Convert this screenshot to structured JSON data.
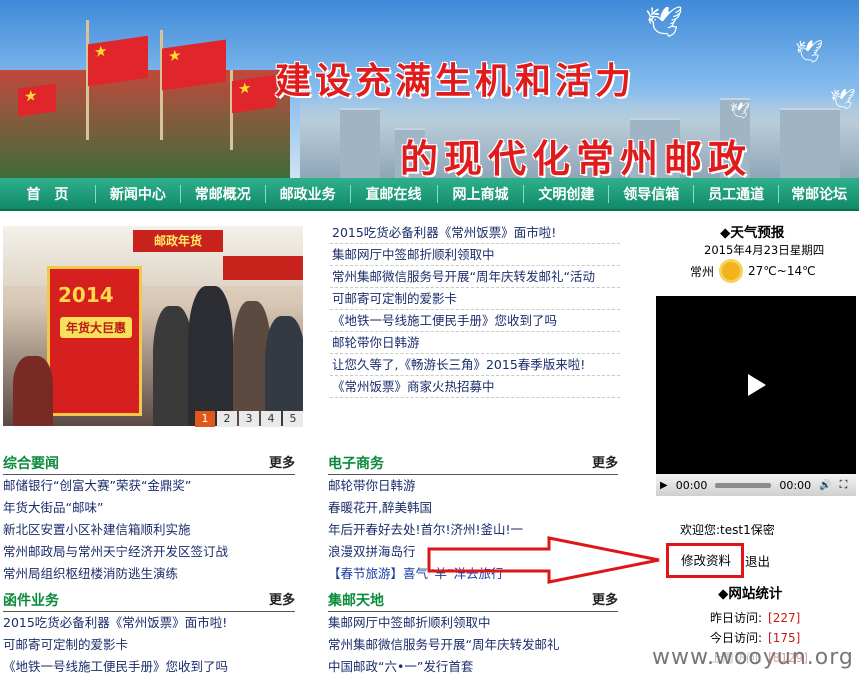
{
  "banner": {
    "slogan_line1": "建设充满生机和活力",
    "slogan_line2": "的现代化常州邮政"
  },
  "nav": {
    "items": [
      "首　页",
      "新闻中心",
      "常邮概况",
      "邮政业务",
      "直邮在线",
      "网上商城",
      "文明创建",
      "领导信箱",
      "员工通道",
      "常邮论坛"
    ]
  },
  "photo": {
    "stall_sign": "邮政年货",
    "poster_year": "2014",
    "poster_text": "年货大巨惠",
    "pager": [
      "1",
      "2",
      "3",
      "4",
      "5"
    ],
    "active_page": "1"
  },
  "top_news": [
    "2015吃货必备利器《常州饭票》面市啦!",
    "集邮网厅中签邮折顺利领取中",
    "常州集邮微信服务号开展“周年庆转发邮礼“活动",
    "可邮寄可定制的爱影卡",
    "《地铁一号线施工便民手册》您收到了吗",
    "邮轮带你日韩游",
    "让您久等了,《畅游长三角》2015春季版来啦!",
    "《常州饭票》商家火热招募中"
  ],
  "sections": {
    "zonghe": {
      "title": "综合要闻",
      "more": "更多",
      "items": [
        "邮储银行“创富大赛”荣获“金鼎奖”",
        "年货大街品“邮味”",
        "新北区安置小区补建信箱顺利实施",
        "常州邮政局与常州天宁经济开发区签订战",
        "常州局组织枢纽楼消防逃生演练"
      ]
    },
    "dianzi": {
      "title": "电子商务",
      "more": "更多",
      "items": [
        "邮轮带你日韩游",
        "春暖花开,醉美韩国",
        "年后开春好去处!首尔!济州!釜山!一",
        "浪漫双拼海岛行",
        "【春节旅游】喜气“羊”洋去旅行"
      ]
    },
    "hanjian": {
      "title": "函件业务",
      "more": "更多",
      "items": [
        "2015吃货必备利器《常州饭票》面市啦!",
        "可邮寄可定制的爱影卡",
        "《地铁一号线施工便民手册》您收到了吗"
      ]
    },
    "jiyou": {
      "title": "集邮天地",
      "more": "更多",
      "items": [
        "集邮网厅中签邮折顺利领取中",
        "常州集邮微信服务号开展“周年庆转发邮礼",
        "中国邮政“六•一”发行首套"
      ]
    }
  },
  "weather": {
    "title": "◆天气预报",
    "date": "2015年4月23日星期四",
    "city": "常州",
    "temp": "27℃~14℃"
  },
  "video": {
    "time_current": "00:00",
    "time_total": "00:00"
  },
  "user": {
    "welcome": "欢迎您:test1保密",
    "edit_profile": "修改资料",
    "logout": "退出"
  },
  "stats": {
    "title": "◆网站统计",
    "yesterday_label": "昨日访问:",
    "yesterday_value": "[227]",
    "today_label": "今日访问:",
    "today_value": "[175]",
    "online_label": "上周访问:",
    "online_value": "[8129]"
  },
  "watermark": "www.wooyun.org",
  "colors": {
    "nav_green": "#118a68",
    "section_title_green": "#0b8a3c",
    "slogan_red": "#e11b1b",
    "annotation_red": "#e01515"
  }
}
